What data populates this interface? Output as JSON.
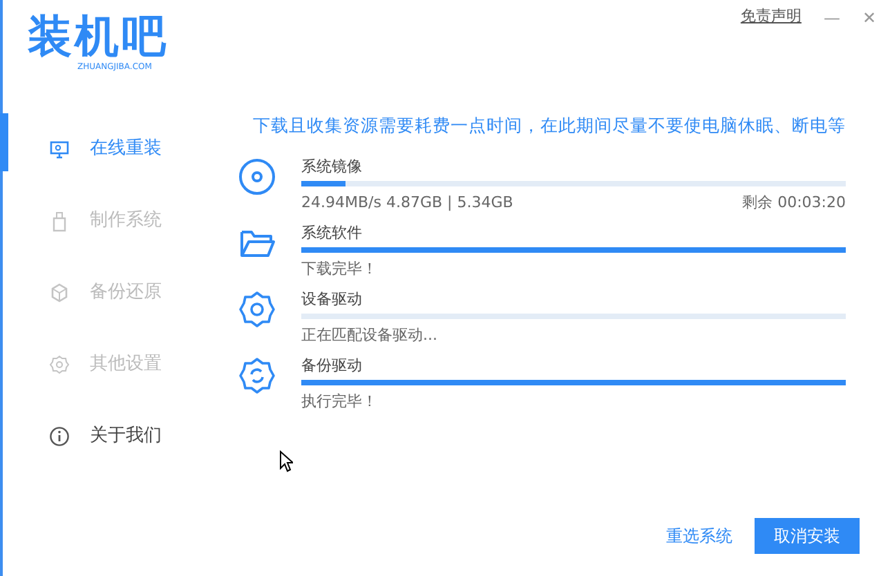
{
  "logo": {
    "title": "装机吧",
    "subtitle": "ZHUANGJIBA.COM"
  },
  "top_links": {
    "disclaimer": "免责声明",
    "minimize": "—",
    "close": "✕"
  },
  "sidebar": {
    "items": [
      {
        "label": "在线重装",
        "kind": "monitor",
        "selected": true,
        "disabled": false
      },
      {
        "label": "制作系统",
        "kind": "usb",
        "selected": false,
        "disabled": true
      },
      {
        "label": "备份还原",
        "kind": "cube",
        "selected": false,
        "disabled": true
      },
      {
        "label": "其他设置",
        "kind": "gear",
        "selected": false,
        "disabled": true
      },
      {
        "label": "关于我们",
        "kind": "info",
        "selected": false,
        "disabled": false
      }
    ]
  },
  "notice": "下载且收集资源需要耗费一点时间，在此期间尽量不要使电脑休眠、断电等",
  "tasks": [
    {
      "kind": "disc",
      "name": "系统镜像",
      "level": 0.08,
      "status": "24.94MB/s 4.87GB | 5.34GB",
      "remaining": "剩余 00:03:20"
    },
    {
      "kind": "folder",
      "name": "系统软件",
      "level": 1,
      "status": "下载完毕！"
    },
    {
      "kind": "gear",
      "name": "设备驱动",
      "level": 0,
      "status": "正在匹配设备驱动..."
    },
    {
      "kind": "gear-sync",
      "name": "备份驱动",
      "level": 1,
      "status": "执行完毕！"
    }
  ],
  "buttons": {
    "reselect": "重选系统",
    "cancel": "取消安装"
  }
}
